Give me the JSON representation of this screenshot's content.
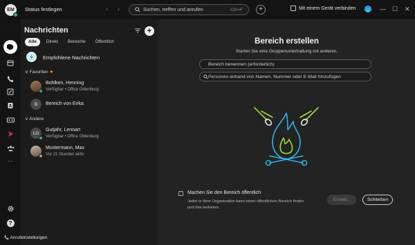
{
  "topbar": {
    "avatar_initials": "EM",
    "status": "Status festlegen",
    "back_glyph": "‹",
    "forward_glyph": "›",
    "search_placeholder": "Suchen, treffen und anrufen",
    "search_shortcut": "Ctrl+F",
    "add_glyph": "+",
    "connect_label": "Mit einem Gerät verbinden",
    "minimize_glyph": "—",
    "maximize_glyph": "☐",
    "close_glyph": "✕"
  },
  "rail": {
    "icons": [
      "messaging-icon",
      "calendar-icon",
      "calls-icon",
      "whiteboard-icon",
      "contacts-icon",
      "voicemail-icon",
      "app-icon",
      "teams-icon",
      "more-icon"
    ],
    "more_glyph": "···",
    "help_glyph": "?"
  },
  "panel": {
    "title": "Nachrichten",
    "add_glyph": "+",
    "tabs": [
      "Alle",
      "Direkt",
      "Bereiche",
      "Öffentlich"
    ],
    "recommended": "Empfohlene Nachrichten",
    "favorites_label": "Favoriten",
    "favorites_star": "★",
    "section_caret": "∨",
    "others_label": "Andere",
    "items": [
      {
        "name": "Bohlken, Henning",
        "sub": "Verfügbar • Office Oldenburg",
        "initials": "",
        "status": "available"
      },
      {
        "name": "Bereich von Erika",
        "sub": "",
        "initials": "B",
        "status": ""
      },
      {
        "name": "Gutjahr, Lennart",
        "sub": "Verfügbar • Office Oldenburg",
        "initials": "LG",
        "status": "available"
      },
      {
        "name": "Mustermann, Max",
        "sub": "Vor 21 Stunden aktiv",
        "initials": "",
        "status": "away"
      }
    ]
  },
  "bottom": {
    "settings_label": "Anrufeinstellungen"
  },
  "main": {
    "title": "Bereich erstellen",
    "subtitle": "Starten Sie eine Gruppenunterhaltung mit anderen.",
    "name_placeholder": "Bereich benennen (erforderlich)",
    "people_placeholder": "Personen anhand von Namen, Nummer oder E-Mail hinzufügen",
    "public_label": "Machen Sie den Bereich öffentlich",
    "public_desc": "Jeder in Ihrer Organisation kann einen öffentlichen Bereich finden und ihm beitreten.",
    "create_button": "Erstell...",
    "close_button": "Schließen"
  },
  "colors": {
    "accent_green": "#2fb36f",
    "illustration_green": "#9be03a",
    "illustration_blue": "#2fb3e8",
    "background": "#232323"
  }
}
